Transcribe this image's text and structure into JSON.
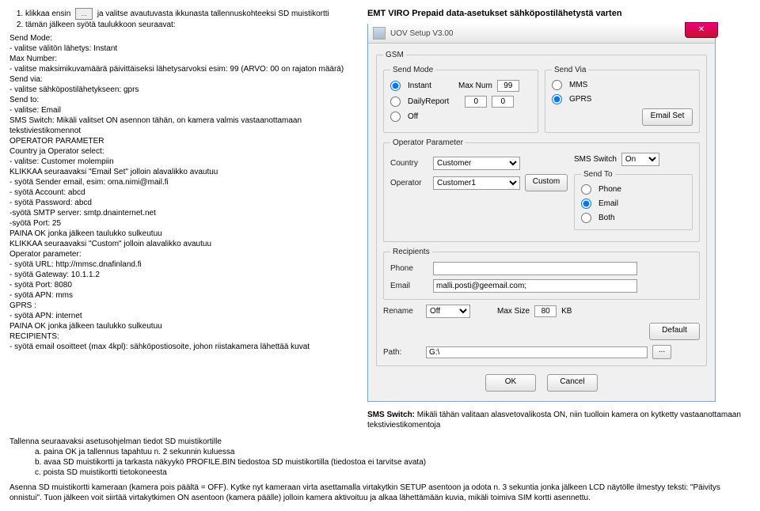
{
  "heading_right": "EMT VIRO Prepaid data-asetukset sähköpostilähetystä varten",
  "steps": {
    "li1_part1": "klikkaa ensin ",
    "li1_part2": " ja valitse avautuvasta ikkunasta tallennuskohteeksi SD muistikortti",
    "li2": "tämän jälkeen syötä taulukkoon seuraavat:",
    "icon_dots": "..."
  },
  "instr": {
    "send_mode": "Send Mode:",
    "instant": " - valitse välitön lähetys: Instant",
    "maxnum": "Max Number:",
    "maxnum_line": " - valitse maksimikuvamäärä päivittäiseksi lähetysarvoksi esim: 99 (ARVO: 00 on rajaton määrä)",
    "sendvia": "Send via:",
    "sendvia_line": " - valitse sähköpostilähetykseen: gprs",
    "sendto": "Send to:",
    "sendto_line": " - valitse: Email",
    "sms": "SMS Switch: Mikäli valitset ON asennon tähän, on kamera valmis vastaanottamaan tekstiviestikomennot",
    "opparm": "OPERATOR PARAMETER",
    "opparm_line": "Country ja Operator select:",
    "opparm_line2": " - valitse: Customer molempiin",
    "klik_email": "KLIKKAA seuraavaksi \"Email Set\" jolloin alavalikko avautuu",
    "sender": " - syötä Sender email, esim: oma.nimi@mail.fi",
    "account": " - syötä Account: abcd",
    "password": " - syötä Password: abcd",
    "smtp": " -syötä SMTP server: smtp.dnainternet.net",
    "port": " -syötä Port: 25",
    "painaok1": "PAINA OK jonka jälkeen taulukko sulkeutuu",
    "klik_custom": "KLIKKAA seuraavaksi \"Custom\" jolloin alavalikko avautuu",
    "opparam2": "Operator parameter:",
    "url": " - syötä URL: http://mmsc.dnafinland.fi",
    "gateway": " - syötä Gateway: 10.1.1.2",
    "port2": " - syötä Port: 8080",
    "apn": " - syötä APN: mms",
    "gprs": "GPRS :",
    "apn2": " - syötä APN: internet",
    "painaok2": "PAINA OK jonka jälkeen taulukko sulkeutuu",
    "recip": "RECIPIENTS:",
    "recip_line": " - syötä email osoitteet (max 4kpl): sähköpostiosoite, johon riistakamera lähettää kuvat"
  },
  "belowcols": {
    "save_title": "Tallenna seuraavaksi asetusohjelman tiedot SD muistikortille",
    "a": "paina OK ja tallennus tapahtuu n. 2 sekunnin kuluessa",
    "b": "avaa SD muistikortti ja tarkasta näkyykö PROFILE.BIN tiedostoa SD muistikortilla (tiedostoa ei tarvitse avata)",
    "c": "poista SD muistikortti tietokoneesta",
    "asenna": "Asenna SD muistikortti kameraan (kamera pois päältä = OFF). Kytke nyt kameraan virta asettamalla virtakytkin SETUP asentoon ja odota n. 3 sekuntia jonka jälkeen LCD näytölle ilmestyy teksti: \"Päivitys onnistui\". Tuon jälkeen voit siirtää virtakytkimen ON asentoon (kamera päälle) jolloin kamera aktivoituu ja alkaa lähettämään kuvia, mikäli toimiva SIM kortti asennettu."
  },
  "win": {
    "title": "UOV Setup V3.00",
    "gsm": "GSM",
    "sendmode_legend": "Send Mode",
    "instant": "Instant",
    "dailyreport": "DailyReport",
    "off": "Off",
    "maxnum_lbl": "Max Num",
    "maxnum_val": "99",
    "zero": "0",
    "sendvia_legend": "Send Via",
    "mms": "MMS",
    "gprs_opt": "GPRS",
    "emailset_btn": "Email Set",
    "opparam_legend": "Operator Parameter",
    "smsswitch_lbl": "SMS Switch",
    "smsswitch_val": "On",
    "country_lbl": "Country",
    "country_val": "Customer",
    "sendto_legend": "Send To",
    "phone_opt": "Phone",
    "email_opt": "Email",
    "both_opt": "Both",
    "operator_lbl": "Operator",
    "operator_val": "Customer1",
    "custom_btn": "Custom",
    "recipients_legend": "Recipients",
    "phone_lbl": "Phone",
    "email_lbl": "Email",
    "email_val": "malli.posti@geemail.com;",
    "rename_lbl": "Rename",
    "rename_val": "Off",
    "maxsize_lbl": "Max Size",
    "maxsize_val": "80",
    "kb": "KB",
    "default_btn": "Default",
    "path_lbl": "Path:",
    "path_val": "G:\\",
    "dots": "...",
    "ok_btn": "OK",
    "cancel_btn": "Cancel"
  },
  "footnote": {
    "text_bold": "SMS Switch:",
    "text": " Mikäli tähän valitaan alasvetovalikosta ON, niin tuolloin kamera on kytketty vastaanottamaan tekstiviestikomentoja"
  }
}
